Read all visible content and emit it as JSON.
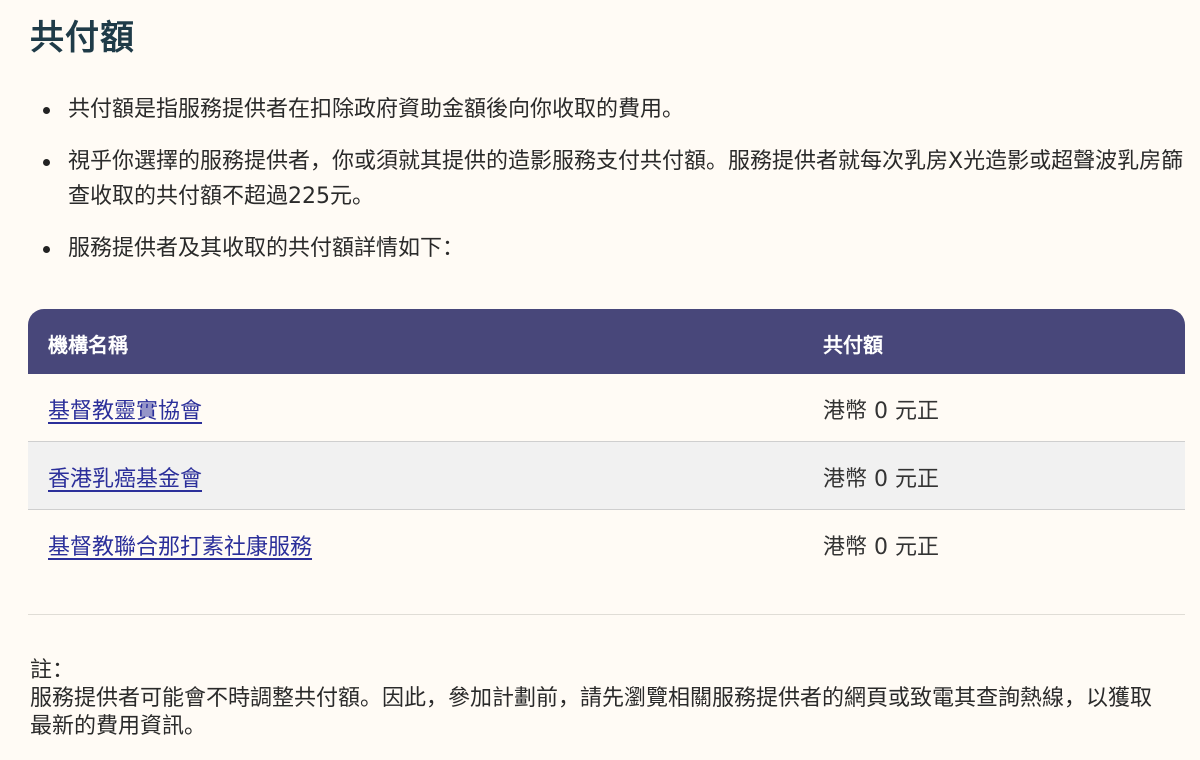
{
  "title": "共付額",
  "bullets": [
    "共付額是指服務提供者在扣除政府資助金額後向你收取的費用。",
    "視乎你選擇的服務提供者，你或須就其提供的造影服務支付共付額。服務提供者就每次乳房X光造影或超聲波乳房篩查收取的共付額不超過225元。",
    "服務提供者及其收取的共付額詳情如下："
  ],
  "table": {
    "headers": [
      "機構名稱",
      "共付額"
    ],
    "rows": [
      {
        "name": "基督教靈實協會",
        "amount": "港幣 0 元正"
      },
      {
        "name": "香港乳癌基金會",
        "amount": "港幣 0 元正"
      },
      {
        "name": "基督教聯合那打素社康服務",
        "amount": "港幣 0 元正"
      }
    ]
  },
  "note": {
    "label": "註：",
    "text": "服務提供者可能會不時調整共付額。因此，參加計劃前，請先瀏覽相關服務提供者的網頁或致電其查詢熱線，以獲取最新的費用資訊。"
  },
  "colors": {
    "background": "#fffbf5",
    "header_bg": "#48477a",
    "title": "#1f3b48",
    "link": "#2b2f9a"
  }
}
